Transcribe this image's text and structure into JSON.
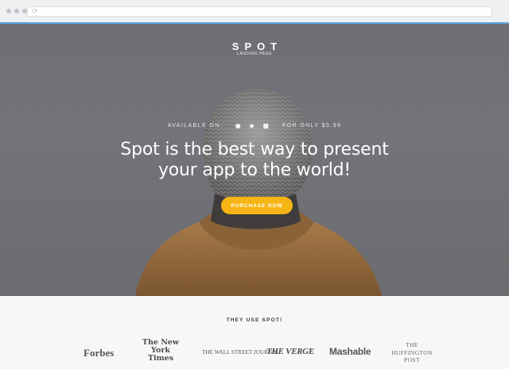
{
  "browser": {
    "reload_icon": "reload-icon"
  },
  "hero": {
    "logo": "SPOT",
    "tagline": "LANDING PAGE",
    "availability_label": "AVAILABLE ON:",
    "platform_icons": [
      "apple-icon",
      "android-icon",
      "windows-icon"
    ],
    "price_text": "FOR ONLY $5.99",
    "headline_line1": "Spot is the best way to present",
    "headline_line2": "your app to the world!",
    "cta_label": "PURCHASE NOW",
    "colors": {
      "accent": "#f6b514",
      "background": "#6f7176"
    }
  },
  "press": {
    "heading": "THEY USE SPOT!",
    "logos": {
      "forbes": "Forbes",
      "nyt": "The New York Times",
      "wsj": "THE WALL STREET JOURNAL",
      "verge": "THE VERGE",
      "mashable": "Mashable",
      "huffington": "THE HUFFINGTON POST"
    }
  }
}
